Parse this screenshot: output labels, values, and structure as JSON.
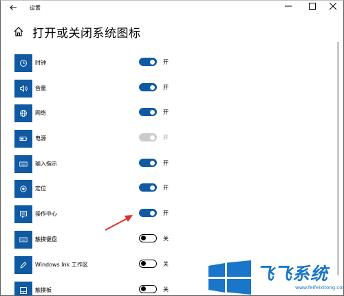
{
  "window": {
    "title": "设置",
    "back_icon": "back-arrow-icon"
  },
  "controls": {
    "minimize": "—",
    "maximize": "☐",
    "close": "✕"
  },
  "page": {
    "title": "打开或关闭系统图标",
    "home_icon": "home-icon"
  },
  "rows": [
    {
      "label": "时钟",
      "state": "开",
      "on": true,
      "disabled": false,
      "icon": "clock-icon"
    },
    {
      "label": "音量",
      "state": "开",
      "on": true,
      "disabled": false,
      "icon": "volume-icon"
    },
    {
      "label": "网络",
      "state": "开",
      "on": true,
      "disabled": false,
      "icon": "globe-icon"
    },
    {
      "label": "电源",
      "state": "开",
      "on": true,
      "disabled": true,
      "icon": "battery-icon"
    },
    {
      "label": "输入指示",
      "state": "开",
      "on": true,
      "disabled": false,
      "icon": "keyboard-icon"
    },
    {
      "label": "定位",
      "state": "开",
      "on": true,
      "disabled": false,
      "icon": "location-icon"
    },
    {
      "label": "操作中心",
      "state": "开",
      "on": true,
      "disabled": false,
      "icon": "action-center-icon"
    },
    {
      "label": "触摸键盘",
      "state": "关",
      "on": false,
      "disabled": false,
      "icon": "touch-keyboard-icon"
    },
    {
      "label": "Windows Ink 工作区",
      "state": "关",
      "on": false,
      "disabled": false,
      "icon": "pen-icon"
    },
    {
      "label": "触摸板",
      "state": "关",
      "on": false,
      "disabled": false,
      "icon": "touchpad-icon"
    }
  ],
  "watermark": {
    "text": "飞飞系统",
    "url": "www.feifeixitong.com"
  },
  "colors": {
    "accent": "#0f5aa3",
    "disabled": "#cccccc",
    "annotation": "#e0302a",
    "watermark": "#1976c8"
  }
}
